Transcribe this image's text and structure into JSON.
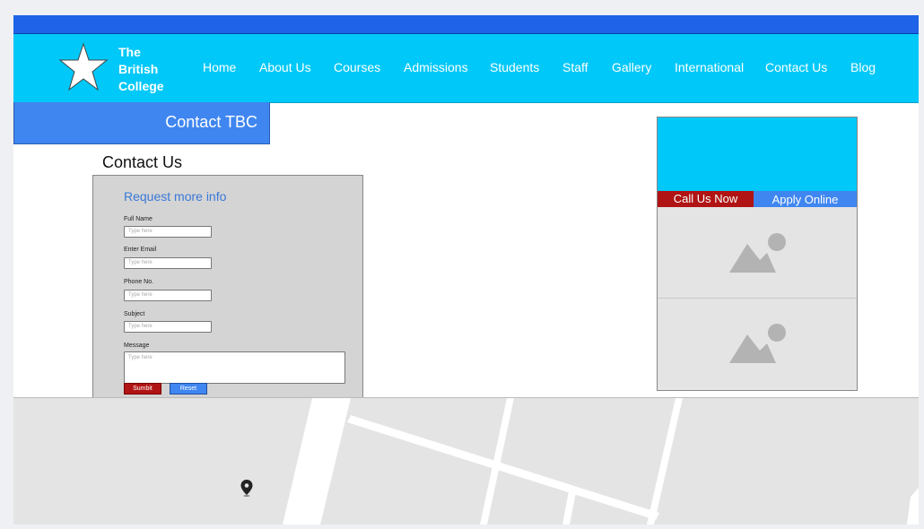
{
  "brand": {
    "line1": "The",
    "line2": "British",
    "line3": "College",
    "logo_icon": "star-icon"
  },
  "nav": {
    "items": [
      {
        "label": "Home"
      },
      {
        "label": "About Us"
      },
      {
        "label": "Courses"
      },
      {
        "label": "Admissions"
      },
      {
        "label": "Students"
      },
      {
        "label": "Staff"
      },
      {
        "label": "Gallery"
      },
      {
        "label": "International"
      },
      {
        "label": "Contact Us"
      },
      {
        "label": "Blog"
      }
    ]
  },
  "page": {
    "banner_title": "Contact TBC",
    "heading": "Contact Us"
  },
  "form": {
    "title": "Request more info",
    "fields": [
      {
        "label": "Full Name",
        "placeholder": "Type here"
      },
      {
        "label": "Enter Email",
        "placeholder": "Type here"
      },
      {
        "label": "Phone No.",
        "placeholder": "Type here"
      },
      {
        "label": "Subject",
        "placeholder": "Type here"
      }
    ],
    "message": {
      "label": "Message",
      "placeholder": "Type here"
    },
    "submit_label": "Sumbit",
    "reset_label": "Reset"
  },
  "sidebar": {
    "call_label": "Call Us Now",
    "apply_label": "Apply Online",
    "image_icon": "image-placeholder-icon"
  },
  "map": {
    "marker_icon": "map-pin-icon"
  },
  "colors": {
    "topbar": "#1e63e8",
    "header": "#00c8f8",
    "banner": "#3f86f0",
    "call": "#b01414",
    "form_bg": "#d4d4d4"
  }
}
